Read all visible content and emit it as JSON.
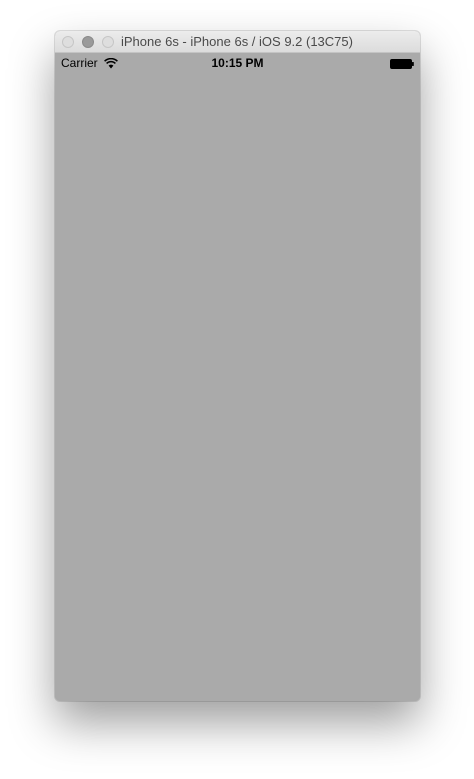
{
  "window": {
    "title": "iPhone 6s - iPhone 6s / iOS 9.2 (13C75)"
  },
  "status_bar": {
    "carrier": "Carrier",
    "time": "10:15 PM",
    "wifi_icon": "wifi-icon",
    "battery_icon": "battery-icon"
  },
  "screen": {
    "background_color": "#aaaaaa"
  }
}
